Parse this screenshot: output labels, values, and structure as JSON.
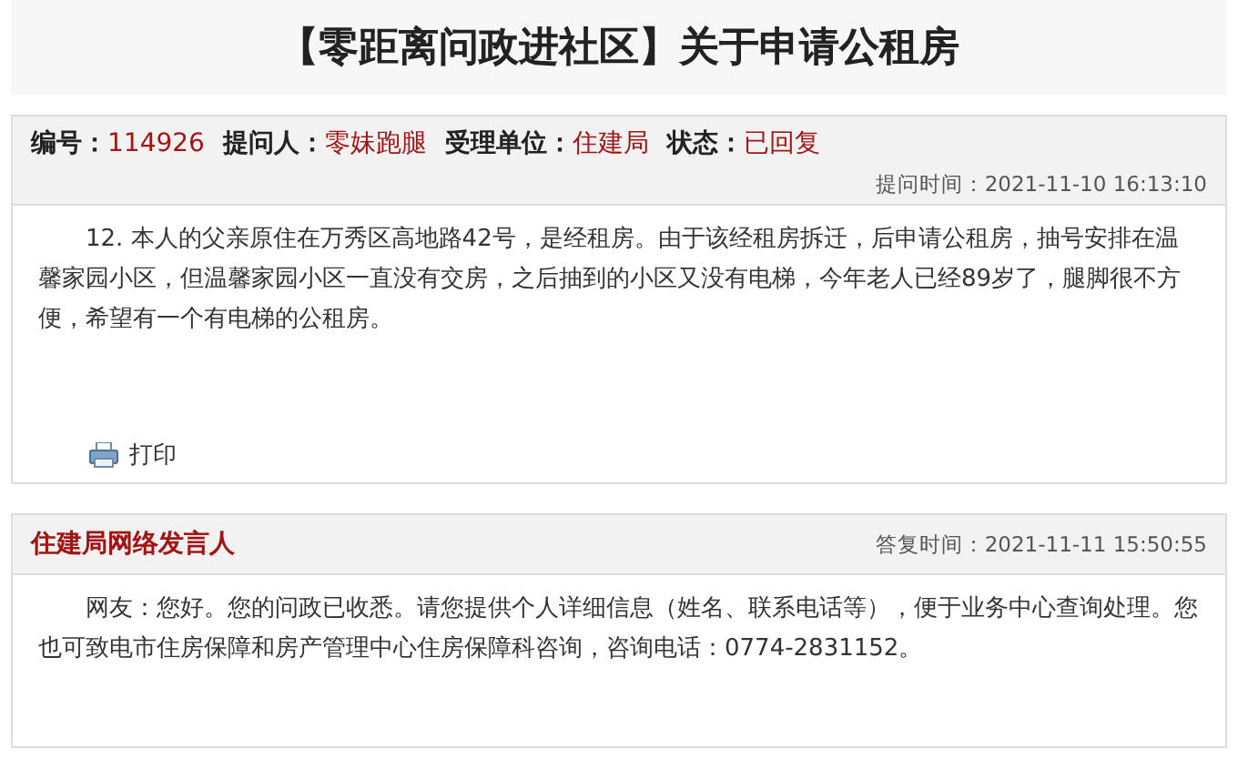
{
  "title": "【零距离问政进社区】关于申请公租房",
  "question": {
    "meta": [
      {
        "label": "编号：",
        "value": "114926"
      },
      {
        "label": "提问人：",
        "value": "零妹跑腿"
      },
      {
        "label": "受理单位：",
        "value": "住建局"
      },
      {
        "label": "状态：",
        "value": "已回复"
      }
    ],
    "time": "提问时间：2021-11-10 16:13:10",
    "body": "12. 本人的父亲原住在万秀区高地路42号，是经租房。由于该经租房拆迁，后申请公租房，抽号安排在温馨家园小区，但温馨家园小区一直没有交房，之后抽到的小区又没有电梯，今年老人已经89岁了，腿脚很不方便，希望有一个有电梯的公租房。",
    "print": "打印"
  },
  "reply": {
    "author": "住建局网络发言人",
    "time": "答复时间：2021-11-11 15:50:55",
    "body": "网友：您好。您的问政已收悉。请您提供个人详细信息（姓名、联系电话等），便于业务中心查询处理。您也可致电市住房保障和房产管理中心住房保障科咨询，咨询电话：0774-2831152。"
  }
}
